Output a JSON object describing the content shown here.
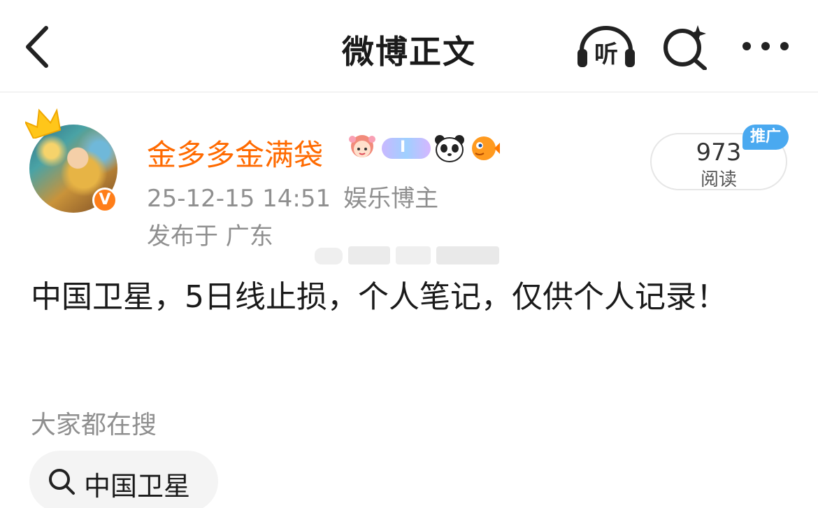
{
  "header": {
    "title": "微博正文",
    "listen_label": "听",
    "back_icon": "chevron-left-icon",
    "search_icon": "sparkle-search-icon",
    "more_icon": "more-dots-icon"
  },
  "author": {
    "name": "金多多金满袋",
    "name_color": "#ff6a00",
    "verified_mark": "V",
    "level_badge": "I",
    "badges": [
      "girl-avatar-badge",
      "level-badge",
      "panda-badge",
      "pufferfish-badge"
    ],
    "timestamp": "25-12-15 14:51",
    "source": "娱乐博主",
    "location": "发布于 广东"
  },
  "stats": {
    "read_count": "973",
    "read_label": "阅读",
    "promo_tag": "推广"
  },
  "post": {
    "text": "中国卫星，5日线止损，个人笔记，仅供个人记录！"
  },
  "related": {
    "label": "大家都在搜",
    "chips": [
      {
        "label": "中国卫星"
      }
    ]
  },
  "colors": {
    "accent": "#ff6a00",
    "promo": "#4aa9f0",
    "muted_text": "#8f8f8f"
  }
}
